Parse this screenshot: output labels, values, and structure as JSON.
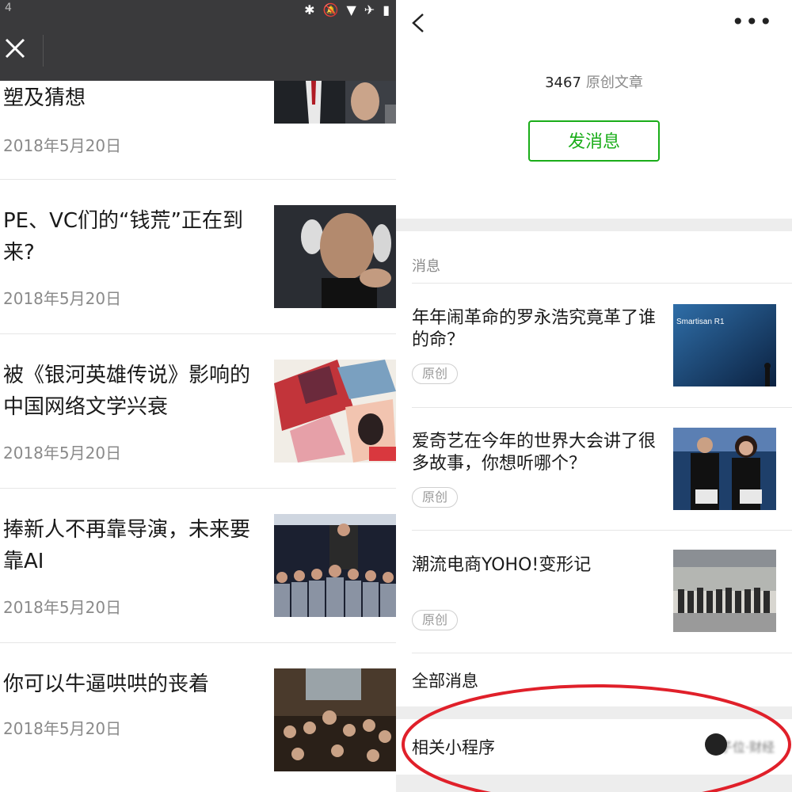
{
  "left": {
    "status_bar": {
      "signal_text": "4"
    },
    "articles": [
      {
        "title": "塑及猜想",
        "date": "2018年5月20日",
        "thumb": "suit-man-hand"
      },
      {
        "title": "PE、VC们的“钱荒”正在到来?",
        "date": "2018年5月20日",
        "thumb": "man-headphones"
      },
      {
        "title": "被《银河英雄传说》影响的中国网络文学兴衰",
        "date": "2018年5月20日",
        "thumb": "collage-books"
      },
      {
        "title": "捧新人不再靠导演，未来要靠AI",
        "date": "2018年5月20日",
        "thumb": "stage-boy-group"
      },
      {
        "title": "你可以牛逼哄哄的丧着",
        "date": "2018年5月20日",
        "thumb": "crowd-hall"
      }
    ]
  },
  "right": {
    "stats": {
      "count": "3467",
      "label": "原创文章"
    },
    "send_button": "发消息",
    "section_label": "消息",
    "messages": [
      {
        "title": "年年闹革命的罗永浩究竟革了谁的命？",
        "tag": "原创",
        "thumb_text": "Smartisan R1"
      },
      {
        "title": "爱奇艺在今年的世界大会讲了很多故事，你想听哪个？",
        "tag": "原创",
        "thumb_text": ""
      },
      {
        "title": "潮流电商YOHO!变形记",
        "tag": "原创",
        "thumb_text": ""
      }
    ],
    "all_messages": "全部消息",
    "mini_program_label": "相关小程序",
    "mini_program_name": "量子位·财经"
  },
  "colors": {
    "nav_dark": "#3a3a3c",
    "accent_green": "#1aad19",
    "annotation_red": "#e0202a"
  }
}
